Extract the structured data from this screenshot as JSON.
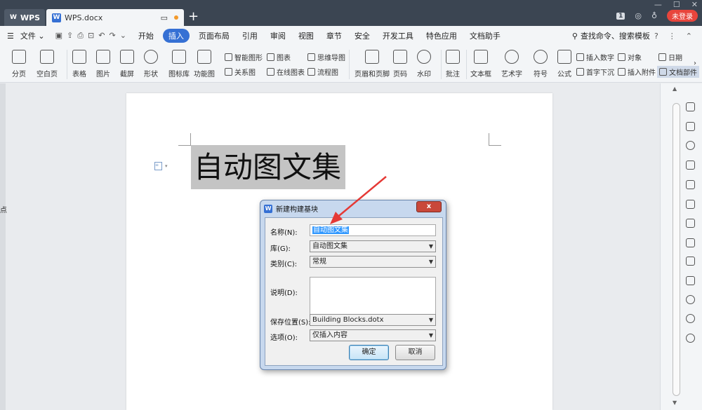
{
  "titlebar": {
    "app_tab": "WPS",
    "doc_tab": "WPS.docx",
    "new_tab": "+",
    "badge": "1",
    "login": "未登录"
  },
  "menubar": {
    "file": "文件",
    "items": [
      "开始",
      "插入",
      "页面布局",
      "引用",
      "审阅",
      "视图",
      "章节",
      "安全",
      "开发工具",
      "特色应用",
      "文档助手"
    ],
    "active_index": 1,
    "search": "查找命令、搜索模板"
  },
  "ribbon": {
    "big": [
      "分页",
      "空白页",
      "表格",
      "图片",
      "截屏",
      "形状",
      "图标库",
      "功能图",
      "页眉和页脚",
      "页码",
      "水印",
      "批注",
      "文本框",
      "艺术字",
      "符号",
      "公式"
    ],
    "small": {
      "smart_graphic": "智能图形",
      "chart": "图表",
      "mind_map": "思维导图",
      "relation": "关系图",
      "online_chart": "在线图表",
      "flow_chart": "流程图",
      "insert_number": "插入数字",
      "object": "对象",
      "date": "日期",
      "drop_cap": "首字下沉",
      "attachment": "插入附件",
      "doc_part": "文档部件"
    }
  },
  "document": {
    "selected_text": "自动图文集",
    "left_fragment": "点"
  },
  "dialog": {
    "title": "新建构建基块",
    "close": "x",
    "name_label": "名称(N):",
    "name_value": "自动图文集",
    "gallery_label": "库(G):",
    "gallery_value": "自动图文集",
    "category_label": "类别(C):",
    "category_value": "常规",
    "description_label": "说明(D):",
    "save_label": "保存位置(S):",
    "save_value": "Building Blocks.dotx",
    "options_label": "选项(O):",
    "options_value": "仅插入内容",
    "ok": "确定",
    "cancel": "取消"
  },
  "colors": {
    "accent": "#3570d4",
    "titlebar": "#3b4552",
    "login": "#e8453c",
    "annotation_arrow": "#e53935"
  }
}
